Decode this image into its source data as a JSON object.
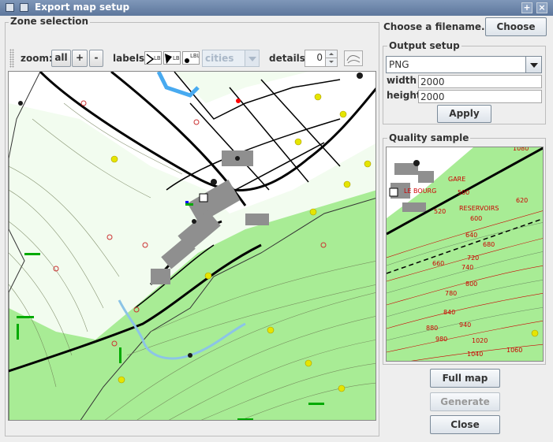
{
  "window": {
    "title": "Export map setup",
    "maximize_glyph": "+",
    "close_glyph": "×"
  },
  "zone": {
    "title": "Zone selection",
    "zoom_label": "zoom:",
    "zoom_all": "all",
    "zoom_in": "+",
    "zoom_out": "-",
    "labels_label": "labels:",
    "label_icon_text": "LBL",
    "category_value": "cities",
    "details_label": "details:",
    "details_value": "0"
  },
  "filename": {
    "label": "Choose a filename...",
    "button": "Choose"
  },
  "output": {
    "title": "Output setup",
    "format": "PNG",
    "width_label": "width",
    "width_value": "2000",
    "height_label": "height",
    "height_value": "2000",
    "apply": "Apply"
  },
  "quality": {
    "title": "Quality sample",
    "map_labels": [
      "GARE",
      "LE BOURG",
      "RESERVOIRS",
      "500",
      "520",
      "600",
      "620",
      "640",
      "680",
      "660",
      "720",
      "740",
      "780",
      "800",
      "840",
      "880",
      "940",
      "980",
      "1020",
      "1040",
      "1060",
      "1080"
    ]
  },
  "actions": {
    "full_map": "Full map",
    "generate": "Generate",
    "close": "Close"
  },
  "colors": {
    "map_green": "#a8ec95",
    "map_white": "#ffffff",
    "contour_red": "#cc0000"
  }
}
